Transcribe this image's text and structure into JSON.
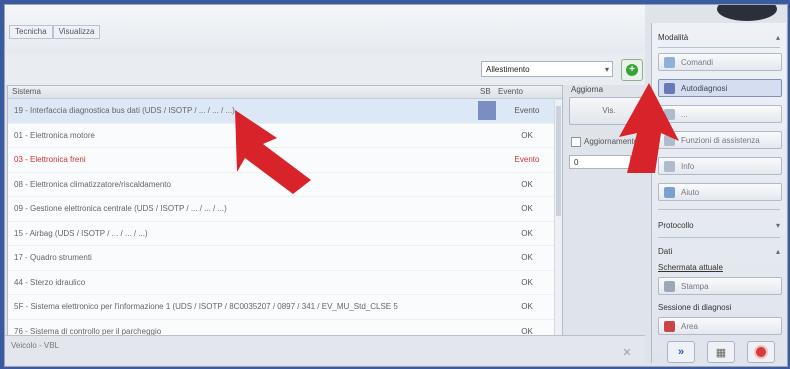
{
  "tabs": [
    "Tecnicha",
    "Visualizza"
  ],
  "toolbar": {
    "dropdown_value": "Allestimento",
    "add_button": "+"
  },
  "list": {
    "headers": {
      "system": "Sistema",
      "sb": "SB",
      "stato": "Evento"
    },
    "rows": [
      {
        "name": "19 - Interfaccia diagnostica bus dati (UDS / ISOTP / ... / ... / ...)",
        "status": "Evento",
        "error": false,
        "selected": true
      },
      {
        "name": "01 - Elettronica motore",
        "status": "OK",
        "error": false,
        "selected": false
      },
      {
        "name": "03 - Elettronica freni",
        "status": "Evento",
        "error": true,
        "selected": false
      },
      {
        "name": "08 - Elettronica climatizzatore/riscaldamento",
        "status": "OK",
        "error": false,
        "selected": false
      },
      {
        "name": "09 - Gestione elettronica centrale (UDS / ISOTP / ... / ... / ...)",
        "status": "OK",
        "error": false,
        "selected": false
      },
      {
        "name": "15 - Airbag (UDS / ISOTP / ... / ... / ...)",
        "status": "OK",
        "error": false,
        "selected": false
      },
      {
        "name": "17 - Quadro strumenti",
        "status": "OK",
        "error": false,
        "selected": false
      },
      {
        "name": "44 - Sterzo idraulico",
        "status": "OK",
        "error": false,
        "selected": false
      },
      {
        "name": "5F - Sistema elettronico per l'informazione 1 (UDS / ISOTP / 8C0035207 / 0897 / 341 / EV_MU_Std_CLSE 5",
        "status": "OK",
        "error": false,
        "selected": false
      },
      {
        "name": "76 - Sistema di controllo per il parcheggio",
        "status": "OK",
        "error": false,
        "selected": false
      }
    ]
  },
  "middle": {
    "title": "Aggiorna",
    "button": "Vis.",
    "checkbox": "Aggiornamento",
    "number": "0"
  },
  "right": {
    "group1": "Modalità",
    "buttons1": [
      "Comandi",
      "Autodiagnosi",
      "...",
      "Funzioni di assistenza",
      "Info",
      "Aiuto"
    ],
    "group2": "Protocollo",
    "group3": "Dati",
    "subtitle1": "Schermata attuale",
    "btn_stampa": "Stampa",
    "subtitle2": "Sessione di diagnosi",
    "btn_area": "Area"
  },
  "status": {
    "text": "Veicolo - VBL"
  },
  "colors": {
    "frame": "#3c5aa0",
    "error": "#c33333",
    "arrow": "#d8232a",
    "add_green": "#37a437"
  }
}
